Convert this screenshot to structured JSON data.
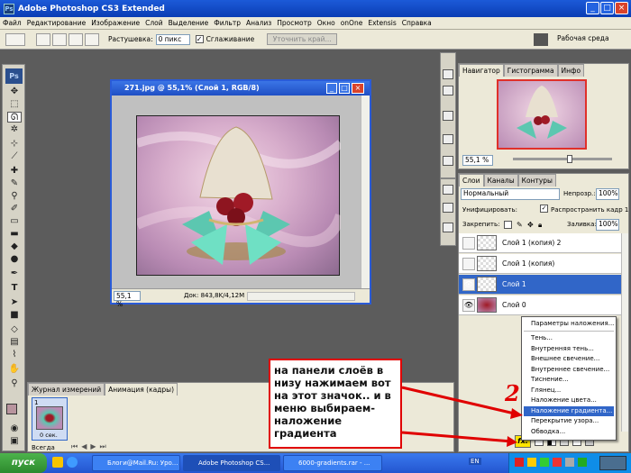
{
  "window": {
    "title": "Adobe Photoshop CS3 Extended",
    "app_icon": "Ps"
  },
  "menu": [
    "Файл",
    "Редактирование",
    "Изображение",
    "Слой",
    "Выделение",
    "Фильтр",
    "Анализ",
    "Просмотр",
    "Окно",
    "onOne",
    "Extensis",
    "Справка"
  ],
  "options": {
    "feather_label": "Растушевка:",
    "feather_value": "0 пикс",
    "antialias_label": "Сглаживание",
    "refine_button": "Уточнить край...",
    "workspace_label": "Рабочая среда"
  },
  "document": {
    "title": "271.jpg @ 55,1% (Слой 1, RGB/8)",
    "zoom": "55,1 %",
    "doc_info": "Док: 843,8K/4,12M"
  },
  "navigator": {
    "tabs": [
      "Навигатор",
      "Гистограмма",
      "Инфо"
    ],
    "zoom": "55,1 %"
  },
  "layers": {
    "tabs": [
      "Слои",
      "Каналы",
      "Контуры"
    ],
    "blend_mode": "Нормальный",
    "opacity_label": "Непрозр.:",
    "opacity_value": "100%",
    "unify_label": "Унифицировать:",
    "propagate_label": "Распространить кадр 1",
    "lock_label": "Закрепить:",
    "fill_label": "Заливка:",
    "fill_value": "100%",
    "items": [
      {
        "name": "Слой 1 (копия) 2",
        "visible": false,
        "selected": false
      },
      {
        "name": "Слой 1 (копия)",
        "visible": false,
        "selected": false
      },
      {
        "name": "Слой 1",
        "visible": true,
        "selected": true
      },
      {
        "name": "Слой 0",
        "visible": true,
        "selected": false
      }
    ]
  },
  "context_menu": {
    "items": [
      "Параметры наложения...",
      "Тень...",
      "Внутренняя тень...",
      "Внешнее свечение...",
      "Внутреннее свечение...",
      "Тиснение...",
      "Глянец...",
      "Наложение цвета...",
      "Наложение градиента...",
      "Перекрытие узора...",
      "Обводка..."
    ],
    "highlighted_index": 8
  },
  "animation": {
    "tabs": [
      "Журнал измерений",
      "Анимация (кадры)"
    ],
    "frame_number": "1",
    "frame_time": "0 сек.",
    "loop": "Всегда"
  },
  "annotation": {
    "text": "на панели слоёв в низу нажимаем вот на этот значок.. и в меню выбираем-наложение градиента",
    "number": "2"
  },
  "taskbar": {
    "start": "пуск",
    "tasks": [
      {
        "label": "Блоги@Mail.Ru: Уро...",
        "active": false
      },
      {
        "label": "Adobe Photoshop CS...",
        "active": true
      },
      {
        "label": "6000-gradients.rar - ...",
        "active": false
      }
    ],
    "lang": "EN"
  },
  "colors": {
    "title_blue": "#0a3db4",
    "selection_blue": "#3166c8",
    "annotation_red": "#e00000",
    "chrome": "#ece9d8"
  }
}
